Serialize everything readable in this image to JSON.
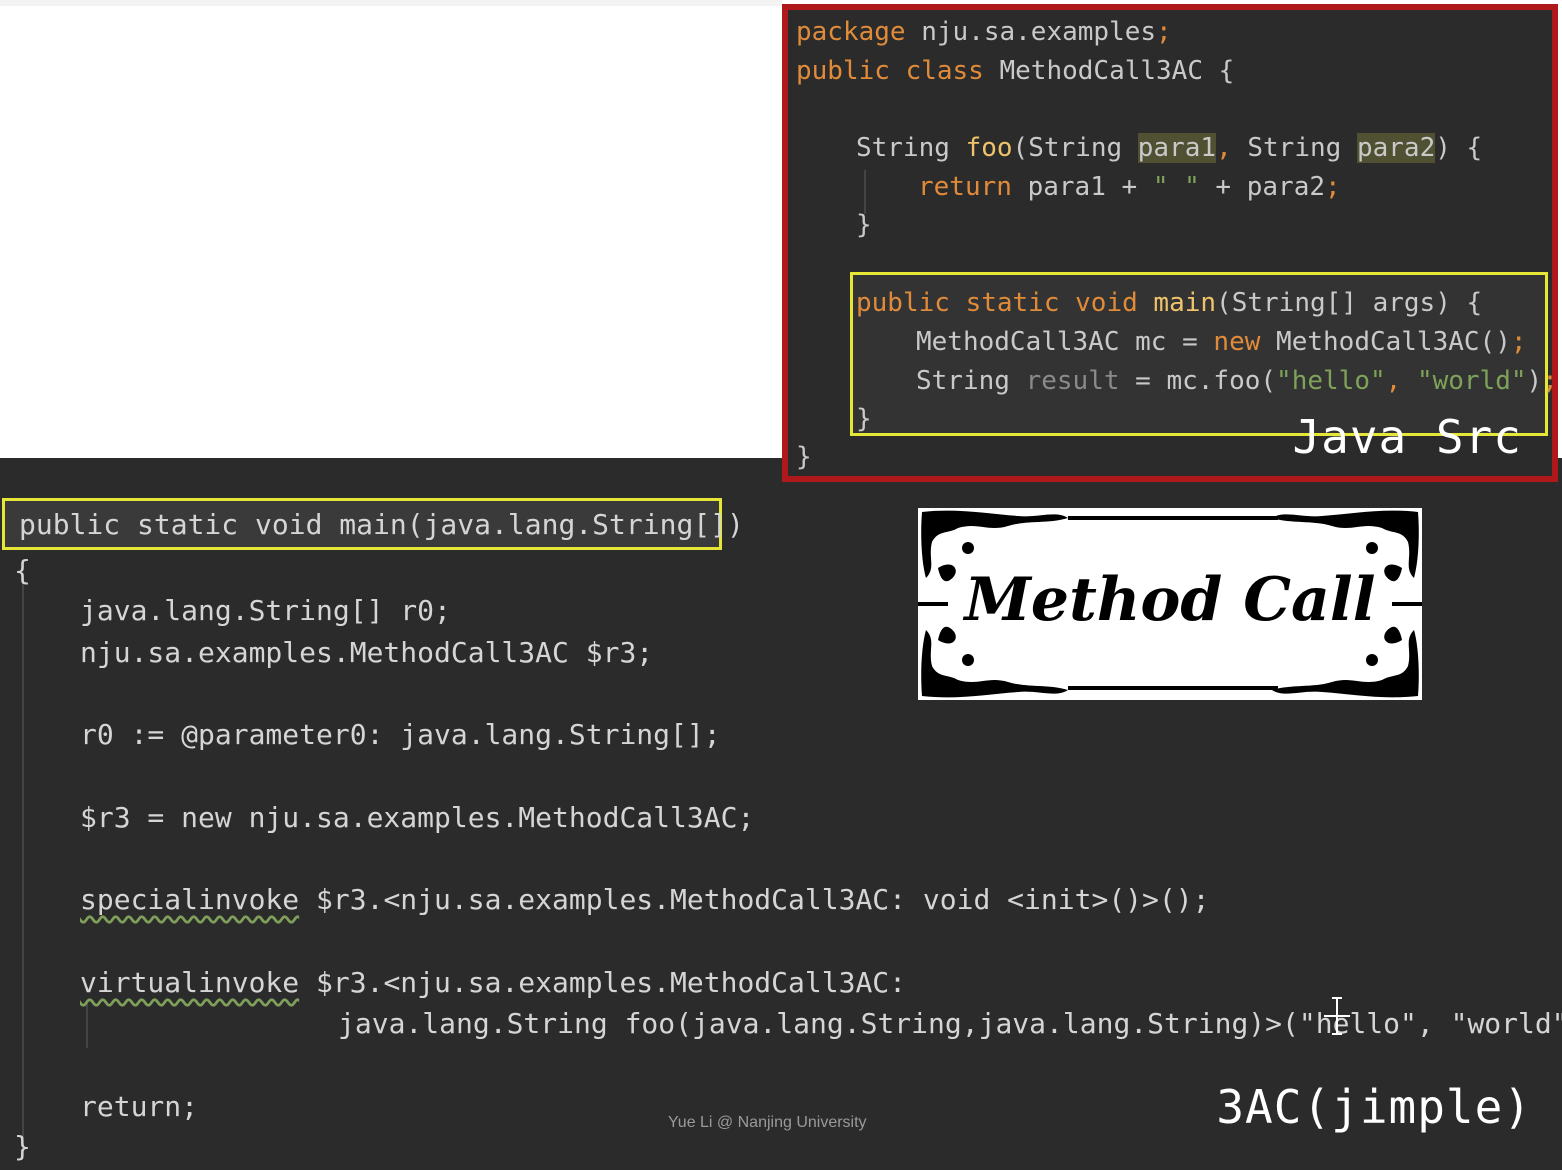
{
  "java_src": {
    "label": "Java Src",
    "lines": [
      {
        "id": "l1",
        "parts": [
          {
            "t": "package ",
            "c": "kw"
          },
          {
            "t": "nju.sa.examples",
            "c": ""
          },
          {
            "t": ";",
            "c": "kw"
          }
        ]
      },
      {
        "id": "l2",
        "parts": [
          {
            "t": "public class ",
            "c": "kw"
          },
          {
            "t": "MethodCall3AC {",
            "c": ""
          }
        ]
      },
      {
        "id": "l3",
        "parts": [
          {
            "t": "String ",
            "c": ""
          },
          {
            "t": "foo",
            "c": "fn"
          },
          {
            "t": "(String ",
            "c": ""
          },
          {
            "t": "para1",
            "c": "hl"
          },
          {
            "t": ", ",
            "c": "kw"
          },
          {
            "t": "String ",
            "c": ""
          },
          {
            "t": "para2",
            "c": "hl"
          },
          {
            "t": ") {",
            "c": ""
          }
        ]
      },
      {
        "id": "l4",
        "parts": [
          {
            "t": "return ",
            "c": "kw"
          },
          {
            "t": "para1 + ",
            "c": ""
          },
          {
            "t": "\" \"",
            "c": "str"
          },
          {
            "t": " + para2",
            "c": ""
          },
          {
            "t": ";",
            "c": "kw"
          }
        ]
      },
      {
        "id": "l5",
        "parts": [
          {
            "t": "}",
            "c": ""
          }
        ]
      },
      {
        "id": "l6",
        "parts": [
          {
            "t": "public static void ",
            "c": "kw"
          },
          {
            "t": "main",
            "c": "fn"
          },
          {
            "t": "(String[] args) {",
            "c": ""
          }
        ]
      },
      {
        "id": "l7",
        "parts": [
          {
            "t": "MethodCall3AC mc = ",
            "c": ""
          },
          {
            "t": "new ",
            "c": "kw"
          },
          {
            "t": "MethodCall3AC()",
            "c": ""
          },
          {
            "t": ";",
            "c": "kw"
          }
        ]
      },
      {
        "id": "l8",
        "parts": [
          {
            "t": "String ",
            "c": ""
          },
          {
            "t": "result",
            "c": "dim"
          },
          {
            "t": " = mc.foo(",
            "c": ""
          },
          {
            "t": "\"hello\"",
            "c": "str"
          },
          {
            "t": ", ",
            "c": "kw"
          },
          {
            "t": "\"world\"",
            "c": "str"
          },
          {
            "t": ")",
            "c": ""
          },
          {
            "t": ";",
            "c": "kw"
          }
        ]
      },
      {
        "id": "l9",
        "parts": [
          {
            "t": "}",
            "c": ""
          }
        ]
      },
      {
        "id": "l10",
        "parts": [
          {
            "t": "}",
            "c": ""
          }
        ]
      }
    ]
  },
  "banner": {
    "title": "Method Call"
  },
  "jimple": {
    "label": "3AC(jimple)",
    "signature": "public static void main(java.lang.String[])",
    "open_brace": "{",
    "decl1": "java.lang.String[] r0;",
    "decl2": "nju.sa.examples.MethodCall3AC $r3;",
    "param_assign": "r0 := @parameter0: java.lang.String[];",
    "new_stmt": "$r3 = new nju.sa.examples.MethodCall3AC;",
    "special_kw": "specialinvoke",
    "special_rest": " $r3.<nju.sa.examples.MethodCall3AC: void <init>()>();",
    "virtual_kw": "virtualinvoke",
    "virtual_rest": " $r3.<nju.sa.examples.MethodCall3AC:",
    "virtual_cont": "java.lang.String foo(java.lang.String,java.lang.String)>(\"hello\", \"world\");",
    "return_stmt": "return;",
    "close_brace": "}"
  },
  "credit": "Yue Li @ Nanjing University"
}
